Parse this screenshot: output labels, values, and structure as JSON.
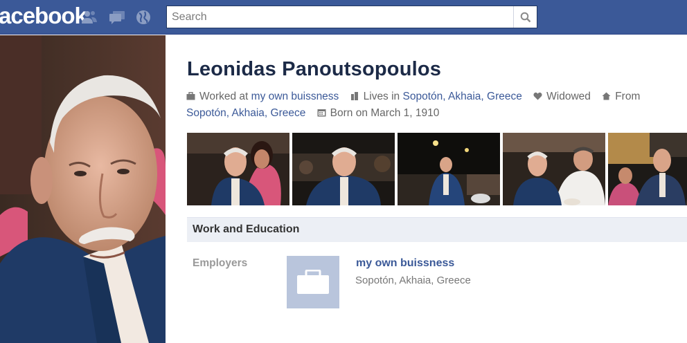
{
  "header": {
    "logo": "facebook",
    "search": {
      "placeholder": "Search",
      "value": ""
    }
  },
  "profile": {
    "name": "Leonidas Panoutsopoulos",
    "info": {
      "worked_prefix": "Worked at ",
      "worked_link": "my own buissness",
      "lives_prefix": "Lives in ",
      "lives_link": "Sopotón, Akhaia, Greece",
      "status": "Widowed",
      "from_prefix": "From",
      "from_link": "Sopotón, Akhaia, Greece",
      "born": "Born on March 1, 1910"
    }
  },
  "photos_strip": {
    "count": 5
  },
  "work_education": {
    "title": "Work and Education",
    "employers_label": "Employers",
    "employer": {
      "name": "my own buissness",
      "location": "Sopotón, Akhaia, Greece"
    }
  },
  "colors": {
    "brand_blue": "#3b5998",
    "link_blue": "#3b5998",
    "section_bg": "#eceff5",
    "employer_logo_bg": "#b9c5dc"
  },
  "icons": [
    "friends-icon",
    "messages-icon",
    "notifications-globe-icon",
    "search-icon",
    "briefcase-icon",
    "house-icon",
    "heart-icon",
    "calendar-icon"
  ]
}
